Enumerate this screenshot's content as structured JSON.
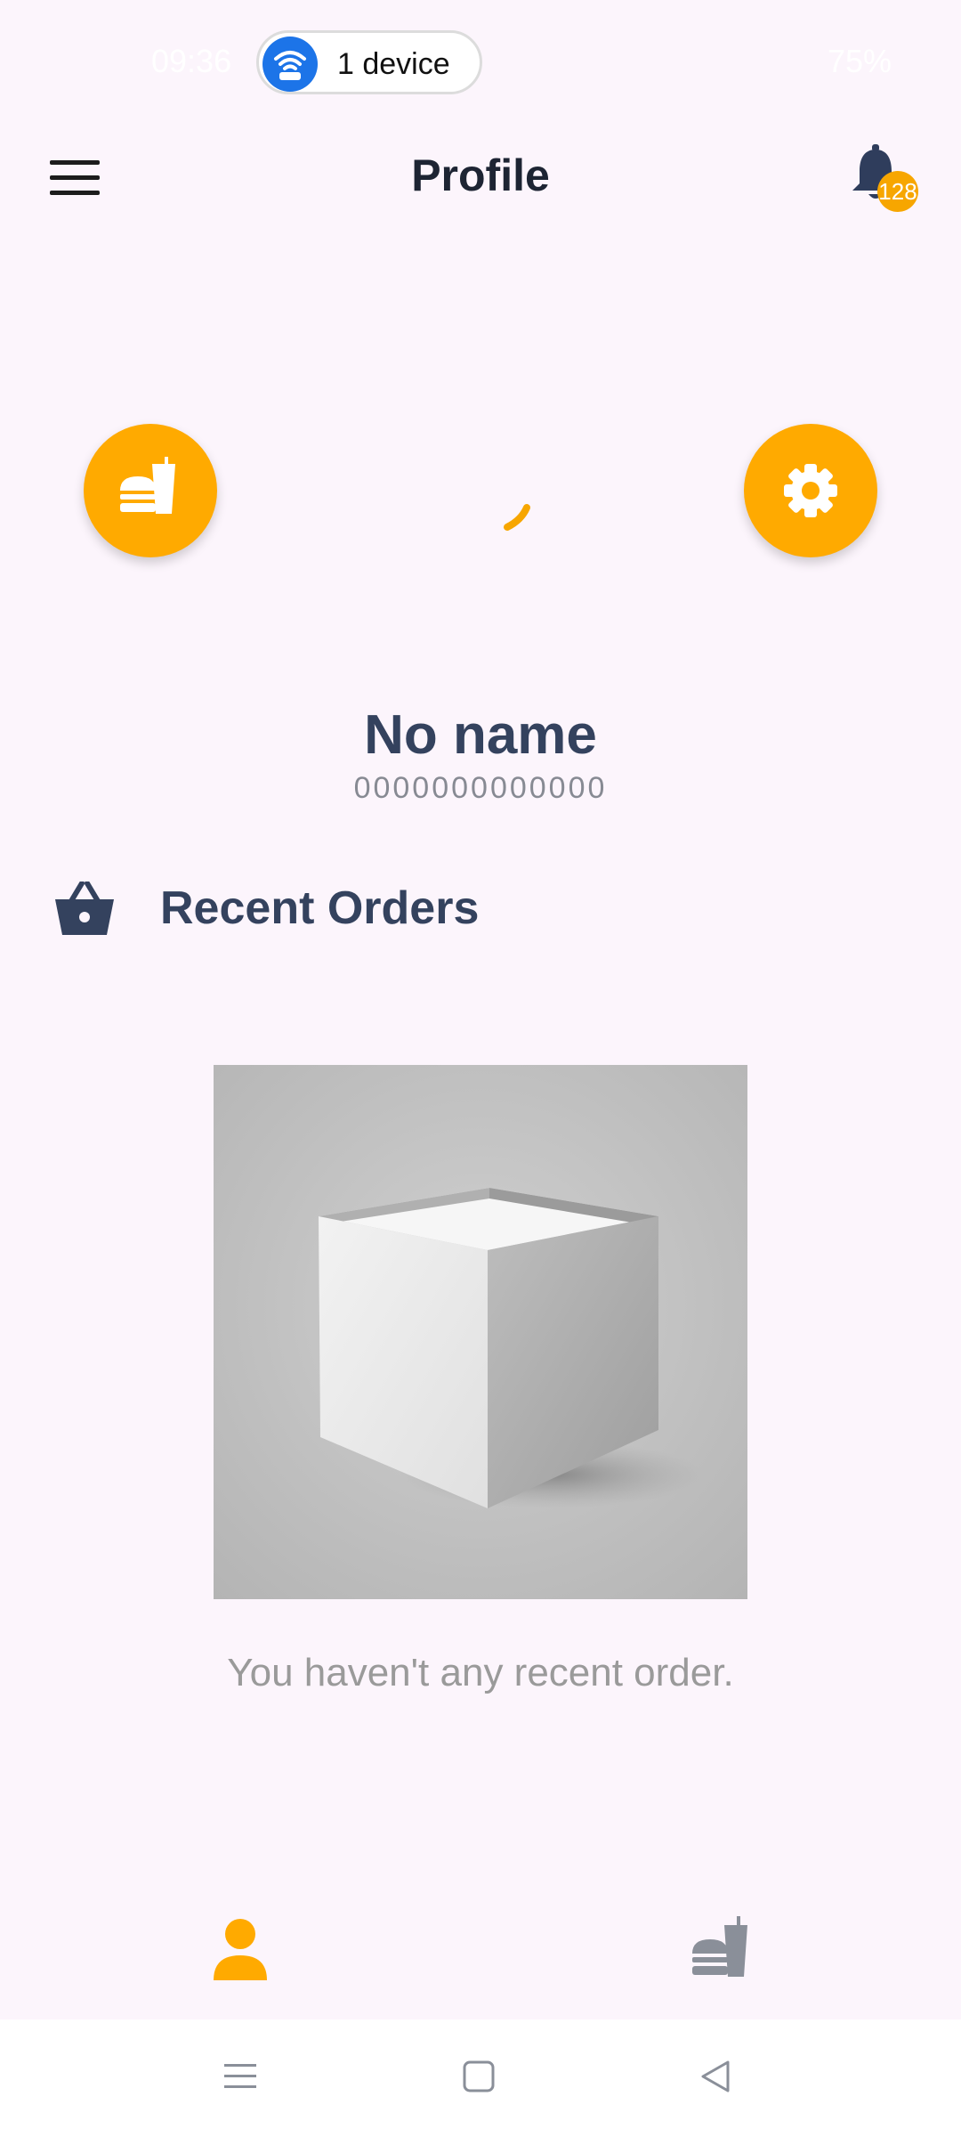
{
  "status_bar": {
    "time": "09:36",
    "hotspot_label": "1 device",
    "battery": "75%",
    "icons": [
      "wifi-hotspot-icon",
      "signal-icon",
      "battery-icon"
    ]
  },
  "app_bar": {
    "title": "Profile",
    "notification_count": "128",
    "icons": [
      "menu-icon",
      "bell-icon"
    ]
  },
  "actions": {
    "icons": [
      "fast-food-icon",
      "gear-icon"
    ]
  },
  "profile": {
    "name": "No name",
    "phone": "0000000000000"
  },
  "recent_orders": {
    "title": "Recent Orders",
    "empty_message": "You haven't any recent order."
  },
  "bottom_nav": {
    "items": [
      {
        "icon": "person-icon",
        "active": true
      },
      {
        "icon": "fast-food-icon",
        "active": false
      }
    ]
  },
  "system_nav": {
    "icons": [
      "recents-icon",
      "home-icon",
      "back-icon"
    ]
  },
  "colors": {
    "accent": "#ffaa00",
    "title_dark": "#34425e",
    "background": "#fcf5fc"
  }
}
